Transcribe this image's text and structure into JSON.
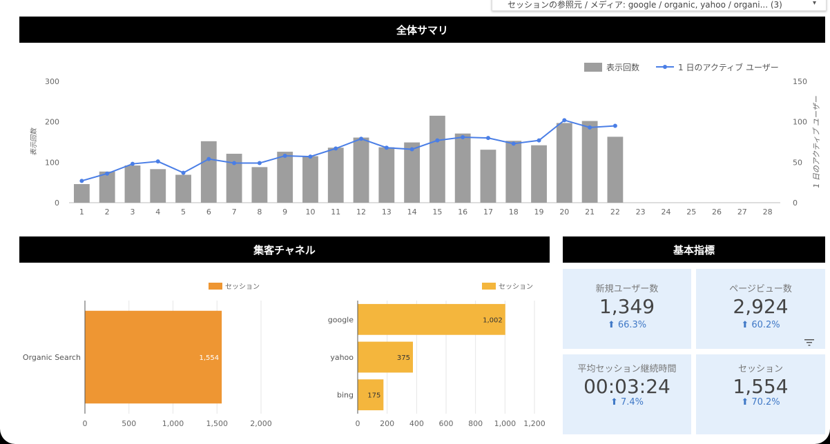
{
  "filter_control": {
    "text": "セッションの参照元 / メディア: google / organic, yahoo / organi... (3)",
    "caret": "▾"
  },
  "sections": {
    "summary_title": "全体サマリ",
    "channel_title": "集客チャネル",
    "kpi_title": "基本指標"
  },
  "chart_data": [
    {
      "type": "bar",
      "combo_line_series": true,
      "legend_position": "top-right",
      "categories": [
        "1",
        "2",
        "3",
        "4",
        "5",
        "6",
        "7",
        "8",
        "9",
        "10",
        "11",
        "12",
        "13",
        "14",
        "15",
        "16",
        "17",
        "18",
        "19",
        "20",
        "21",
        "22",
        "23",
        "24",
        "25",
        "26",
        "27",
        "28"
      ],
      "series": [
        {
          "name": "表示回数",
          "type": "bar",
          "axis": "left",
          "color": "#9e9e9e",
          "values": [
            46,
            77,
            92,
            83,
            69,
            152,
            121,
            88,
            126,
            115,
            136,
            161,
            137,
            149,
            215,
            171,
            131,
            153,
            142,
            197,
            202,
            163,
            null,
            null,
            null,
            null,
            null,
            null
          ]
        },
        {
          "name": "1 日のアクティブ ユーザー",
          "type": "line",
          "axis": "right",
          "color": "#4a7ee6",
          "values": [
            27,
            36,
            48,
            51,
            37,
            54,
            49,
            49,
            58,
            57,
            67,
            79,
            68,
            66,
            77,
            81,
            80,
            73,
            77,
            102,
            93,
            95,
            null,
            null,
            null,
            null,
            null,
            null
          ]
        }
      ],
      "ylabel": "表示回数",
      "y2label": "1 日のアクティブ ユーザー",
      "ylim": [
        0,
        300
      ],
      "y2lim": [
        0,
        150
      ],
      "yticks": [
        0,
        100,
        200,
        300
      ],
      "y2ticks": [
        0,
        50,
        100,
        150
      ]
    },
    {
      "type": "bar",
      "orientation": "horizontal",
      "legend_position": "top",
      "categories": [
        "Organic Search"
      ],
      "series": [
        {
          "name": "セッション",
          "color": "#ee9633",
          "values": [
            1554
          ]
        }
      ],
      "data_labels": [
        "1,554"
      ],
      "xlim": [
        0,
        2000
      ],
      "xticks": [
        "0",
        "500",
        "1,000",
        "1,500",
        "2,000"
      ],
      "xtick_values": [
        0,
        500,
        1000,
        1500,
        2000
      ]
    },
    {
      "type": "bar",
      "orientation": "horizontal",
      "legend_position": "top",
      "categories": [
        "google",
        "yahoo",
        "bing"
      ],
      "series": [
        {
          "name": "セッション",
          "color": "#f4b63d",
          "values": [
            1002,
            375,
            175
          ]
        }
      ],
      "data_labels": [
        "1,002",
        "375",
        "175"
      ],
      "xlim": [
        0,
        1200
      ],
      "xticks": [
        "0",
        "200",
        "400",
        "600",
        "800",
        "1,000",
        "1,200"
      ],
      "xtick_values": [
        0,
        200,
        400,
        600,
        800,
        1000,
        1200
      ]
    }
  ],
  "kpis": [
    {
      "label": "新規ユーザー数",
      "value": "1,349",
      "delta": "⬆ 66.3%"
    },
    {
      "label": "ページビュー数",
      "value": "2,924",
      "delta": "⬆ 60.2%"
    },
    {
      "label": "平均セッション継続時間",
      "value": "00:03:24",
      "delta": "⬆ 7.4%"
    },
    {
      "label": "セッション",
      "value": "1,554",
      "delta": "⬆ 70.2%"
    }
  ],
  "icons": {
    "filter": "filter-lines-icon",
    "caret": "chevron-down-icon"
  }
}
